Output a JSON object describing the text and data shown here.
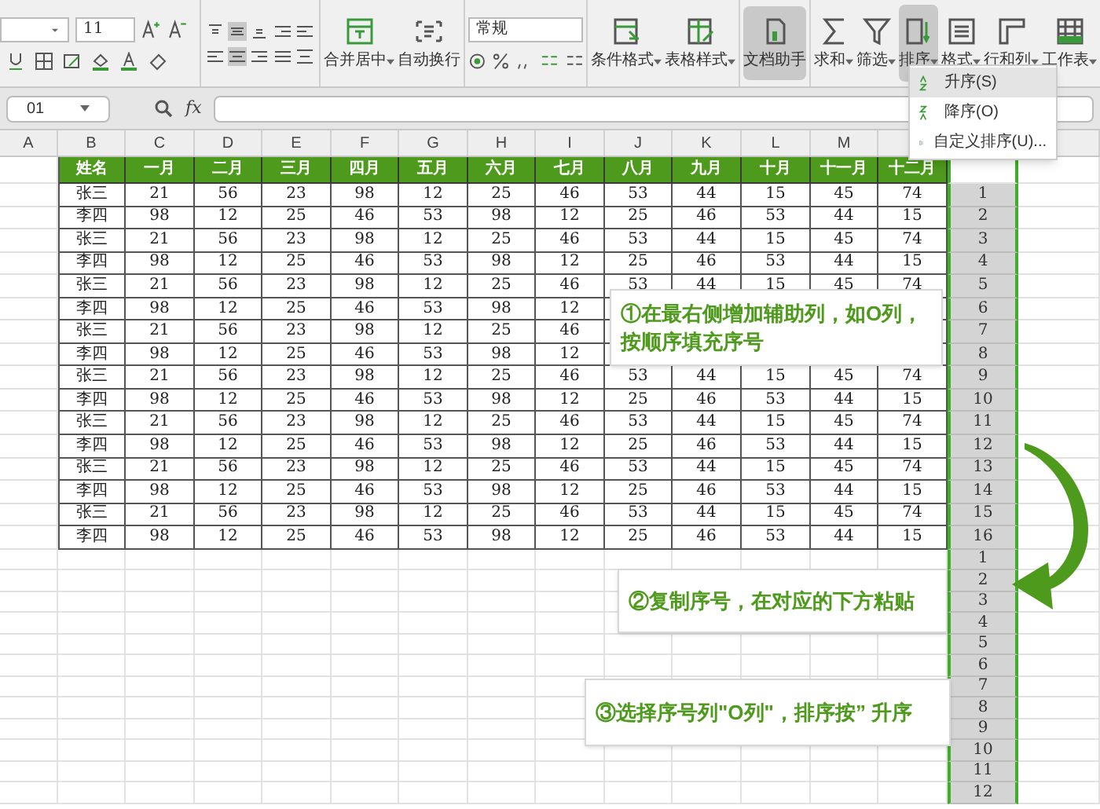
{
  "toolbar": {
    "font_size": "11",
    "number_format": "常规",
    "buttons": [
      {
        "label": "合并居中",
        "dropdown": true,
        "selected": false
      },
      {
        "label": "自动换行",
        "dropdown": false,
        "selected": false
      },
      {
        "label": "条件格式",
        "dropdown": true,
        "selected": false
      },
      {
        "label": "表格样式",
        "dropdown": true,
        "selected": false
      },
      {
        "label": "文档助手",
        "dropdown": false,
        "selected": true
      },
      {
        "label": "求和",
        "dropdown": true,
        "selected": false
      },
      {
        "label": "筛选",
        "dropdown": true,
        "selected": false
      },
      {
        "label": "排序",
        "dropdown": true,
        "selected": true
      },
      {
        "label": "格式",
        "dropdown": true,
        "selected": false
      },
      {
        "label": "行和列",
        "dropdown": true,
        "selected": false
      },
      {
        "label": "工作表",
        "dropdown": true,
        "selected": false
      }
    ]
  },
  "sort_menu": {
    "items": [
      {
        "label": "升序(S)",
        "selected": true
      },
      {
        "label": "降序(O)",
        "selected": false
      },
      {
        "label": "自定义排序(U)...",
        "selected": false
      }
    ]
  },
  "name_box": {
    "value": "01"
  },
  "formula_bar": {
    "fx_label": "fx"
  },
  "column_header_bar": {
    "letters": [
      "A",
      "B",
      "C",
      "D",
      "E",
      "F",
      "G",
      "H",
      "I",
      "J",
      "K",
      "L",
      "M"
    ]
  },
  "sheet": {
    "header_row": [
      "姓名",
      "一月",
      "二月",
      "三月",
      "四月",
      "五月",
      "六月",
      "七月",
      "八月",
      "九月",
      "十月",
      "十一月",
      "十二月"
    ],
    "rows": [
      [
        "张三",
        "21",
        "56",
        "23",
        "98",
        "12",
        "25",
        "46",
        "53",
        "44",
        "15",
        "45",
        "74"
      ],
      [
        "李四",
        "98",
        "12",
        "25",
        "46",
        "53",
        "98",
        "12",
        "25",
        "46",
        "53",
        "44",
        "15"
      ],
      [
        "张三",
        "21",
        "56",
        "23",
        "98",
        "12",
        "25",
        "46",
        "53",
        "44",
        "15",
        "45",
        "74"
      ],
      [
        "李四",
        "98",
        "12",
        "25",
        "46",
        "53",
        "98",
        "12",
        "25",
        "46",
        "53",
        "44",
        "15"
      ],
      [
        "张三",
        "21",
        "56",
        "23",
        "98",
        "12",
        "25",
        "46",
        "53",
        "44",
        "15",
        "45",
        "74"
      ],
      [
        "李四",
        "98",
        "12",
        "25",
        "46",
        "53",
        "98",
        "12",
        null,
        null,
        null,
        null,
        null
      ],
      [
        "张三",
        "21",
        "56",
        "23",
        "98",
        "12",
        "25",
        "46",
        null,
        null,
        null,
        null,
        null
      ],
      [
        "李四",
        "98",
        "12",
        "25",
        "46",
        "53",
        "98",
        "12",
        null,
        null,
        null,
        null,
        null
      ],
      [
        "张三",
        "21",
        "56",
        "23",
        "98",
        "12",
        "25",
        "46",
        "53",
        "44",
        "15",
        "45",
        "74"
      ],
      [
        "李四",
        "98",
        "12",
        "25",
        "46",
        "53",
        "98",
        "12",
        "25",
        "46",
        "53",
        "44",
        "15"
      ],
      [
        "张三",
        "21",
        "56",
        "23",
        "98",
        "12",
        "25",
        "46",
        "53",
        "44",
        "15",
        "45",
        "74"
      ],
      [
        "李四",
        "98",
        "12",
        "25",
        "46",
        "53",
        "98",
        "12",
        "25",
        "46",
        "53",
        "44",
        "15"
      ],
      [
        "张三",
        "21",
        "56",
        "23",
        "98",
        "12",
        "25",
        "46",
        "53",
        "44",
        "15",
        "45",
        "74"
      ],
      [
        "李四",
        "98",
        "12",
        "25",
        "46",
        "53",
        "98",
        "12",
        "25",
        "46",
        "53",
        "44",
        "15"
      ],
      [
        "张三",
        "21",
        "56",
        "23",
        "98",
        "12",
        "25",
        "46",
        "53",
        "44",
        "15",
        "45",
        "74"
      ],
      [
        "李四",
        "98",
        "12",
        "25",
        "46",
        "53",
        "98",
        "12",
        "25",
        "46",
        "53",
        "44",
        "15"
      ]
    ],
    "helper_column": {
      "selected": true,
      "numbers": [
        "1",
        "2",
        "3",
        "4",
        "5",
        "6",
        "7",
        "8",
        "9",
        "10",
        "11",
        "12",
        "13",
        "14",
        "15",
        "16"
      ],
      "pasted_numbers": [
        "1",
        "2",
        "3",
        "4",
        "5",
        "6",
        "7",
        "8",
        "9",
        "10",
        "11",
        "12"
      ]
    }
  },
  "annotations": [
    {
      "text": "①在最右侧增加辅助列，如O列，按顺序填充序号"
    },
    {
      "text": "②复制序号，在对应的下方粘贴"
    },
    {
      "text": "③选择序号列\"O列\"，排序按” 升序"
    }
  ]
}
